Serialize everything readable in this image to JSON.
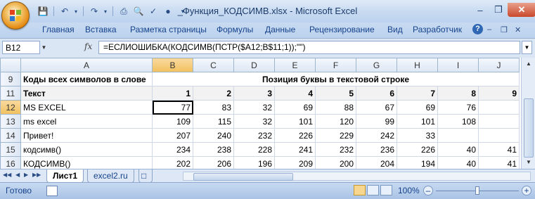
{
  "window": {
    "title": "_Функция_КОДСИМВ.xlsx - Microsoft Excel",
    "qat_icons": [
      "save-icon",
      "undo-icon",
      "redo-icon",
      "print-icon",
      "print-preview-icon",
      "spelling-icon",
      "circle-icon"
    ]
  },
  "ribbon": {
    "tabs": [
      "Главная",
      "Вставка",
      "Разметка страницы",
      "Формулы",
      "Данные",
      "Рецензирование",
      "Вид",
      "Разработчик"
    ],
    "help": "?"
  },
  "formula_bar": {
    "name_box": "B12",
    "fx": "fx",
    "formula": "=ЕСЛИОШИБКА(КОДСИМВ(ПСТР($A12;B$11;1));\"\")"
  },
  "grid": {
    "columns": [
      "A",
      "B",
      "C",
      "D",
      "E",
      "F",
      "G",
      "H",
      "I",
      "J"
    ],
    "selected_column": "B",
    "selected_row": "12",
    "rows": [
      {
        "num": "9",
        "cells": [
          "Коды всех символов в слове",
          "Позиция буквы в текстовой строке",
          "",
          "",
          "",
          "",
          "",
          "",
          "",
          ""
        ],
        "merged_header": true
      },
      {
        "num": "11",
        "cells": [
          "Текст",
          "1",
          "2",
          "3",
          "4",
          "5",
          "6",
          "7",
          "8",
          "9"
        ],
        "bold": true
      },
      {
        "num": "12",
        "cells": [
          "MS EXCEL",
          "77",
          "83",
          "32",
          "69",
          "88",
          "67",
          "69",
          "76",
          ""
        ]
      },
      {
        "num": "13",
        "cells": [
          "ms excel",
          "109",
          "115",
          "32",
          "101",
          "120",
          "99",
          "101",
          "108",
          ""
        ]
      },
      {
        "num": "14",
        "cells": [
          "Привет!",
          "207",
          "240",
          "232",
          "226",
          "229",
          "242",
          "33",
          "",
          ""
        ]
      },
      {
        "num": "15",
        "cells": [
          "кодсимв()",
          "234",
          "238",
          "228",
          "241",
          "232",
          "236",
          "226",
          "40",
          "41"
        ]
      },
      {
        "num": "16",
        "cells": [
          "КОДСИМВ()",
          "202",
          "206",
          "196",
          "209",
          "200",
          "204",
          "194",
          "40",
          "41"
        ]
      }
    ]
  },
  "sheet_tabs": {
    "tabs": [
      "Лист1",
      "excel2.ru"
    ],
    "active": "Лист1"
  },
  "status_bar": {
    "ready": "Готово",
    "zoom": "100%",
    "zoom_fraction": 0.5
  }
}
